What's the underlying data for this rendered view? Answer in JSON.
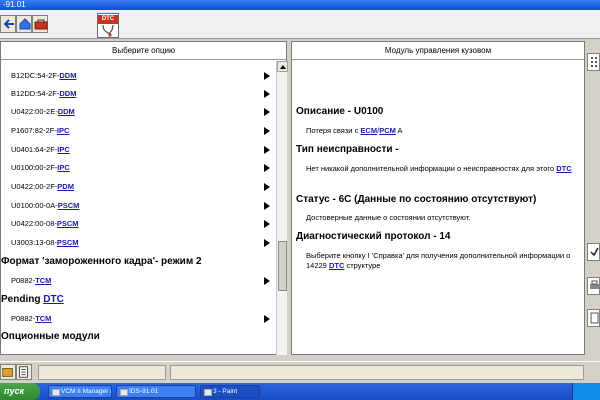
{
  "window": {
    "title": "-91.01"
  },
  "toolbar": {
    "buttons": [
      {
        "icon": "back-arrow-icon"
      },
      {
        "icon": "home-icon"
      },
      {
        "icon": "toolbox-icon"
      }
    ],
    "dtc_label": "DTC"
  },
  "left_panel": {
    "title": "Выберите опцию",
    "rows": [
      {
        "type": "item",
        "prefix": "B12DC:54-2F-",
        "link": "DDM"
      },
      {
        "type": "item",
        "prefix": "B12DD:54-2F-",
        "link": "DDM"
      },
      {
        "type": "item",
        "prefix": "U0422:00-2E-",
        "link": "DDM"
      },
      {
        "type": "item",
        "prefix": "P1607:82-2F-",
        "link": "IPC"
      },
      {
        "type": "item",
        "prefix": "U0401:64-2F-",
        "link": "IPC"
      },
      {
        "type": "item",
        "prefix": "U0100:00-2F-",
        "link": "IPC"
      },
      {
        "type": "item",
        "prefix": "U0422:00-2F-",
        "link": "PDM"
      },
      {
        "type": "item",
        "prefix": "U0100:00-0A-",
        "link": "PSCM"
      },
      {
        "type": "item",
        "prefix": "U0422:00-08-",
        "link": "PSCM"
      },
      {
        "type": "item",
        "prefix": "U3003:13-08-",
        "link": "PSCM"
      },
      {
        "type": "section",
        "prefix": "Формат 'замороженного кадра'- режим 2",
        "link": ""
      },
      {
        "type": "item",
        "prefix": "P0882-",
        "link": "TCM"
      },
      {
        "type": "section",
        "prefix": "Pending ",
        "link": "DTC"
      },
      {
        "type": "item",
        "prefix": "P0882-",
        "link": "TCM"
      },
      {
        "type": "section",
        "prefix": "Опционные модули",
        "link": ""
      }
    ]
  },
  "right_panel": {
    "title": "Модуль управления кузовом",
    "description": {
      "heading": "Описание - U0100",
      "text_before": "Потеря связи с ",
      "link1": "ECM",
      "separator": "/",
      "link2": "PCM",
      "text_after": " A"
    },
    "fault_type": {
      "heading": "Тип неисправности -",
      "text": "Нет никакой дополнительной информации о неисправностях для этого ",
      "link": "DTC"
    },
    "status": {
      "heading": "Статус - 6С (Данные по состоянию отсутствуют)",
      "text": "Достоверные данные о состоянии отсутствуют."
    },
    "protocol": {
      "heading": "Диагностический протокол - 14",
      "text_before": "Выберите кнопку I 'Справка' для получения дополнительной информации о 14229 ",
      "link": "DTC",
      "text_after": " структуре"
    }
  },
  "taskbar": {
    "start_label": "пуск",
    "tasks": [
      {
        "label": "VCM II Manager (Fo..."
      },
      {
        "label": "IDS-91.01"
      },
      {
        "label": "3 - Paint"
      }
    ]
  }
}
